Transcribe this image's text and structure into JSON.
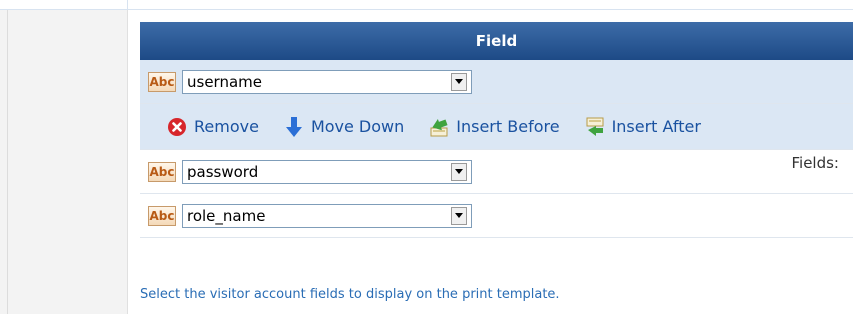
{
  "form": {
    "fields_label": "Fields:",
    "table_header": "Field",
    "hint": "Select the visitor account fields to display on the print template."
  },
  "rows": [
    {
      "icon": "Abc",
      "value": "username"
    },
    {
      "icon": "Abc",
      "value": "password"
    },
    {
      "icon": "Abc",
      "value": "role_name"
    }
  ],
  "actions": {
    "remove": "Remove",
    "move_down": "Move Down",
    "insert_before": "Insert Before",
    "insert_after": "Insert After"
  },
  "colors": {
    "header_bg": "#1d4a86",
    "selected_bg": "#dbe7f4",
    "link": "#1a52a0"
  }
}
